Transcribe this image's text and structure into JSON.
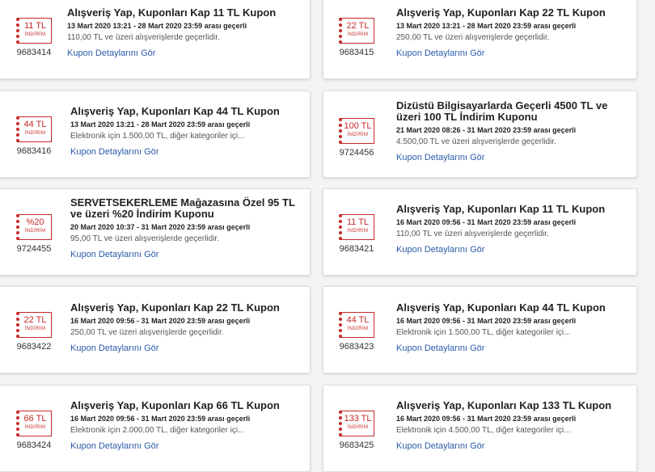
{
  "badge_label": "İNDİRİM",
  "link_label": "Kupon Detaylarını Gör",
  "colors": {
    "accent": "#c62828",
    "link": "#2b5ba8"
  },
  "coupons": [
    {
      "amount": "11 TL",
      "code": "9683414",
      "title": "Alışveriş Yap, Kuponları Kap 11 TL Kupon",
      "date": "13 Mart 2020 13:21 - 28 Mart 2020 23:59 arası geçerli",
      "desc": "110,00 TL ve üzeri alışverişlerde geçerlidir."
    },
    {
      "amount": "22 TL",
      "code": "9683415",
      "title": "Alışveriş Yap, Kuponları Kap 22 TL Kupon",
      "date": "13 Mart 2020 13:21 - 28 Mart 2020 23:59 arası geçerli",
      "desc": "250,00 TL ve üzeri alışverişlerde geçerlidir."
    },
    {
      "amount": "44 TL",
      "code": "9683416",
      "title": "Alışveriş Yap, Kuponları Kap 44 TL Kupon",
      "date": "13 Mart 2020 13:21 - 28 Mart 2020 23:59 arası geçerli",
      "desc": "Elektronik için 1.500,00 TL, diğer kategoriler içi..."
    },
    {
      "amount": "100 TL",
      "code": "9724456",
      "title": "Dizüstü Bilgisayarlarda Geçerli 4500 TL ve üzeri 100 TL İndirim Kuponu",
      "date": "21 Mart 2020 08:26 - 31 Mart 2020 23:59 arası geçerli",
      "desc": "4.500,00 TL ve üzeri alışverişlerde geçerlidir."
    },
    {
      "amount": "%20",
      "code": "9724455",
      "title": "SERVETSEKERLEME Mağazasına Özel 95 TL ve üzeri %20 İndirim Kuponu",
      "date": "20 Mart 2020 10:37 - 31 Mart 2020 23:59 arası geçerli",
      "desc": "95,00 TL ve üzeri alışverişlerde geçerlidir."
    },
    {
      "amount": "11 TL",
      "code": "9683421",
      "title": "Alışveriş Yap, Kuponları Kap 11 TL Kupon",
      "date": "16 Mart 2020 09:56 - 31 Mart 2020 23:59 arası geçerli",
      "desc": "110,00 TL ve üzeri alışverişlerde geçerlidir."
    },
    {
      "amount": "22 TL",
      "code": "9683422",
      "title": "Alışveriş Yap, Kuponları Kap 22 TL Kupon",
      "date": "16 Mart 2020 09:56 - 31 Mart 2020 23:59 arası geçerli",
      "desc": "250,00 TL ve üzeri alışverişlerde geçerlidir."
    },
    {
      "amount": "44 TL",
      "code": "9683423",
      "title": "Alışveriş Yap, Kuponları Kap 44 TL Kupon",
      "date": "16 Mart 2020 09:56 - 31 Mart 2020 23:59 arası geçerli",
      "desc": "Elektronik için 1.500,00 TL, diğer kategoriler içi..."
    },
    {
      "amount": "66 TL",
      "code": "9683424",
      "title": "Alışveriş Yap, Kuponları Kap 66 TL Kupon",
      "date": "16 Mart 2020 09:56 - 31 Mart 2020 23:59 arası geçerli",
      "desc": "Elektronik için 2.000,00 TL, diğer kategoriler içi..."
    },
    {
      "amount": "133 TL",
      "code": "9683425",
      "title": "Alışveriş Yap, Kuponları Kap 133 TL Kupon",
      "date": "16 Mart 2020 09:56 - 31 Mart 2020 23:59 arası geçerli",
      "desc": "Elektronik için 4.500,00 TL, diğer kategoriler içi..."
    }
  ]
}
